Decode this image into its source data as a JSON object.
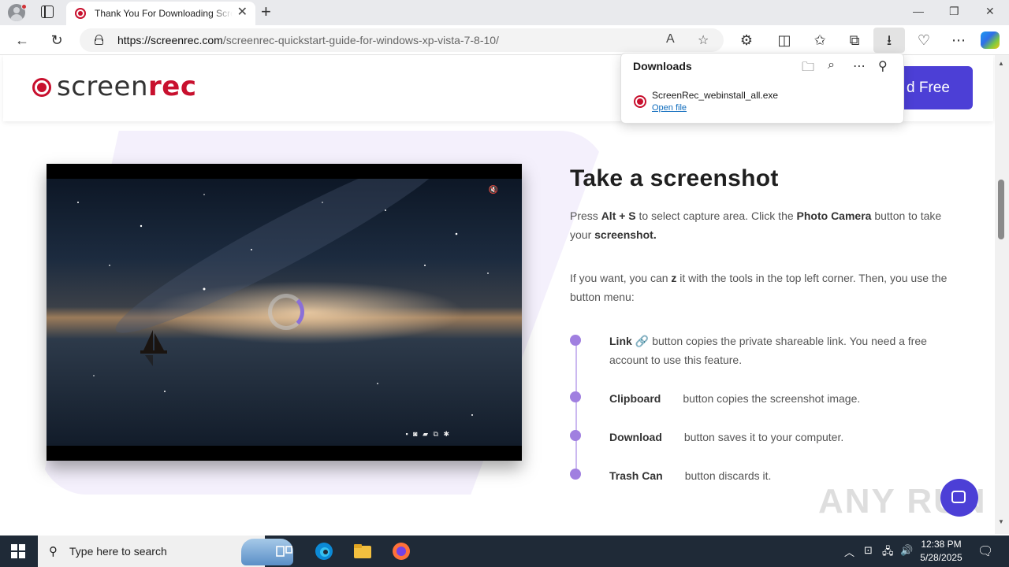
{
  "browser": {
    "tab_title": "Thank You For Downloading ScreenRec",
    "url_domain": "https://screenrec.com",
    "url_path": "/screenrec-quickstart-guide-for-windows-xp-vista-7-8-10/"
  },
  "downloads": {
    "title": "Downloads",
    "file_name": "ScreenRec_webinstall_all.exe",
    "open_label": "Open file"
  },
  "site": {
    "logo_a": "screen",
    "logo_b": "rec",
    "cta_label": "d Free"
  },
  "content": {
    "heading": "Take a screenshot",
    "p1_a": "Press ",
    "p1_b": "Alt + S",
    "p1_c": " to select capture area. Click the ",
    "p1_d": "Photo Camera",
    "p1_e": " button to take your ",
    "p1_f": "screenshot.",
    "p2_a": "If you want, you can ",
    "p2_b": "z",
    "p2_c": " it with the tools in the top left corner. Then, you use the button menu:",
    "items": [
      {
        "label": "Link",
        "text": "button copies the private shareable link. You need a free account to use this feature."
      },
      {
        "label": "Clipboard",
        "text": "button copies the screenshot image."
      },
      {
        "label": "Download",
        "text": "button saves it to your computer."
      },
      {
        "label": "Trash Can",
        "text": "button discards it."
      }
    ]
  },
  "watermark": "ANY RUN",
  "taskbar": {
    "search_placeholder": "Type here to search",
    "time": "12:38 PM",
    "date": "5/28/2025"
  },
  "colors": {
    "brand_red": "#c8102e",
    "brand_purple": "#4c3fd6",
    "timeline_purple": "#a07fe0"
  }
}
